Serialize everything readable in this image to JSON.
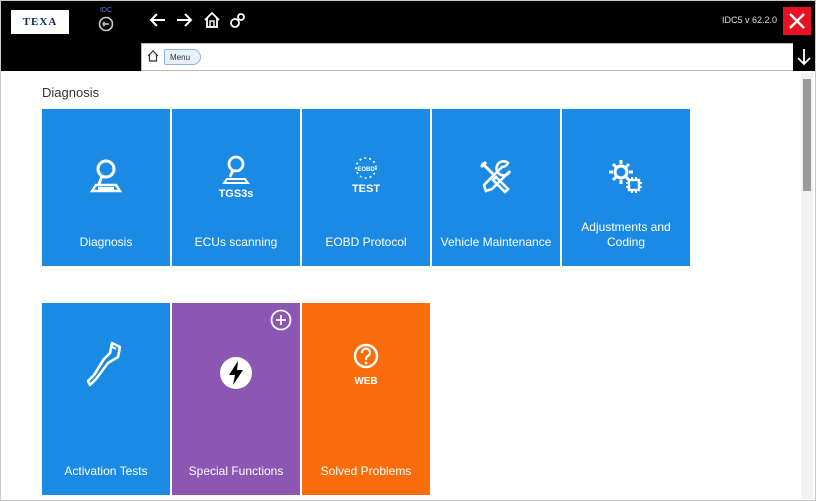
{
  "header": {
    "logo_text": "TEXA",
    "badge_text": "IDC",
    "version": "IDC5 v 62.2.0"
  },
  "breadcrumb": {
    "items": [
      "Menu"
    ]
  },
  "section": {
    "title": "Diagnosis"
  },
  "tiles": [
    {
      "label": "Diagnosis",
      "color": "#1a8ae5",
      "icon": "car-search-icon"
    },
    {
      "label": "ECUs scanning",
      "color": "#1a8ae5",
      "icon": "tgs3s-search-icon",
      "icon_text": "TGS3s"
    },
    {
      "label": "EOBD Protocol",
      "color": "#1a8ae5",
      "icon": "eobd-test-icon",
      "icon_text": "TEST",
      "icon_subtext": "EOBD"
    },
    {
      "label": "Vehicle Maintenance",
      "color": "#1a8ae5",
      "icon": "wrench-screwdriver-icon"
    },
    {
      "label": "Adjustments and Coding",
      "color": "#1a8ae5",
      "icon": "gears-chip-icon"
    },
    {
      "label": "Activation Tests",
      "color": "#1a8ae5",
      "icon": "actuator-icon"
    },
    {
      "label": "Special Functions",
      "color": "#8c56b3",
      "icon": "lightning-icon"
    },
    {
      "label": "Solved Problems",
      "color": "#fa6d0c",
      "icon": "question-web-icon",
      "icon_text": "WEB"
    }
  ],
  "colors": {
    "tile_blue": "#1a8ae5",
    "tile_purple": "#8c56b3",
    "tile_orange": "#fa6d0c",
    "close_red": "#e81123"
  }
}
